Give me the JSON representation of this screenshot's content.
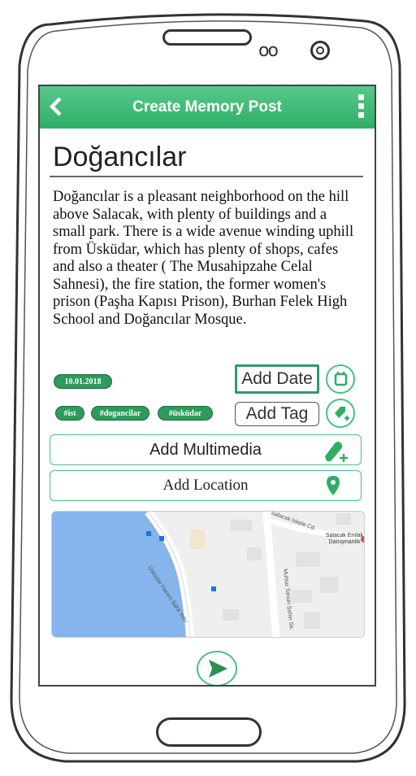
{
  "appbar": {
    "title": "Create Memory Post",
    "back_icon": "chevron-left-icon",
    "menu_icon": "more-vertical-icon"
  },
  "post": {
    "title": "Doğancılar",
    "description": "Doğancılar is a pleasant neighborhood on the hill above Salacak, with plenty of buildings and a small park. There is a wide avenue winding uphill from Üsküdar, which has plenty of shops, cafes and also a theater ( The Musahipzahe Celal Sahnesi), the fire station, the former women's prison (Paşha Kapısı Prison), Burhan Felek High School and Doğancılar Mosque."
  },
  "date": {
    "value": "10.01.2018",
    "button_label": "Add Date",
    "icon": "calendar-icon"
  },
  "tags": {
    "items": [
      "#ist",
      "#dogancilar",
      "#üsküdar"
    ],
    "button_label": "Add Tag",
    "icon": "add-tag-icon"
  },
  "multimedia": {
    "button_label": "Add Multimedia",
    "icon": "attach-add-icon"
  },
  "location": {
    "button_label": "Add Location",
    "icon": "map-pin-icon"
  },
  "map": {
    "labels": {
      "street1": "Salacak İskele Cd.",
      "place": "Salacak Emlak Danışmanlık",
      "street2": "Üsküdar Harem Sahil Yolu",
      "street3": "Muhtar Tahsin Şahin Sk."
    }
  },
  "send": {
    "icon": "send-icon"
  },
  "colors": {
    "accent": "#2fae66",
    "accent_light": "#4bbf84",
    "water": "#86b4ec"
  }
}
